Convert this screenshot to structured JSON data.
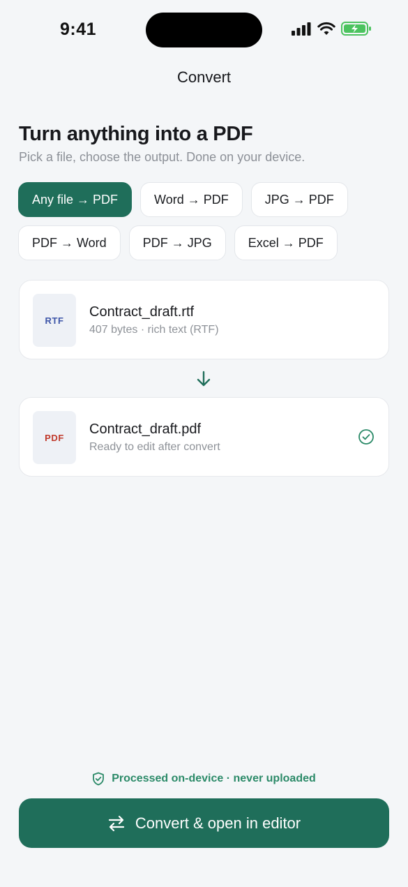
{
  "status_bar": {
    "time": "9:41"
  },
  "nav": {
    "title": "Convert"
  },
  "hero": {
    "title": "Turn anything into a PDF",
    "subtitle": "Pick a file, choose the output. Done on your device."
  },
  "chips": [
    [
      {
        "label": "Any file → PDF",
        "active": true
      },
      {
        "label": "Word → PDF",
        "active": false
      },
      {
        "label": "JPG → PDF",
        "active": false
      }
    ],
    [
      {
        "label": "PDF → Word",
        "active": false
      },
      {
        "label": "PDF → JPG",
        "active": false
      },
      {
        "label": "Excel → PDF",
        "active": false
      }
    ]
  ],
  "source_file": {
    "badge": "RTF",
    "name": "Contract_draft.rtf",
    "meta": "407 bytes · rich text (RTF)"
  },
  "output_file": {
    "badge": "PDF",
    "name": "Contract_draft.pdf",
    "meta": "Ready to edit after convert"
  },
  "footer": {
    "privacy_note": "Processed on-device · never uploaded",
    "convert_label": "Convert & open in editor"
  },
  "colors": {
    "accent": "#1F6E5A",
    "rtf_badge": "#3D55A8",
    "pdf_badge": "#C0392B",
    "privacy_text": "#2B8A68"
  },
  "icons": [
    "signal-icon",
    "wifi-icon",
    "battery-icon",
    "arrow-down-icon",
    "check-circle-icon",
    "shield-check-icon",
    "swap-arrows-icon"
  ]
}
